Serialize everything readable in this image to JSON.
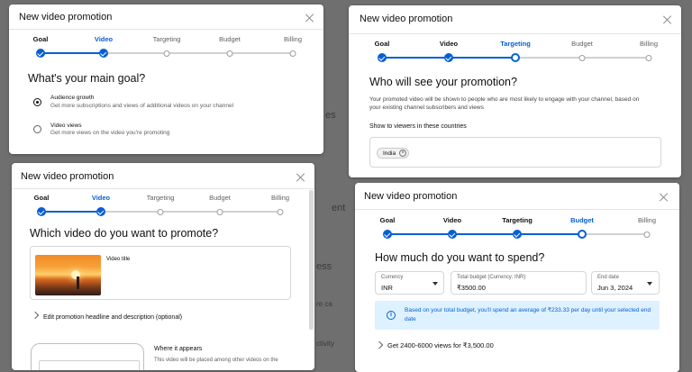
{
  "background": {
    "fragments": [
      "es",
      "ent",
      "ess",
      "re ca",
      "ss",
      "ctivity",
      "es",
      "re",
      "ss"
    ]
  },
  "dialog1": {
    "title": "New video promotion",
    "steps": [
      {
        "label": "Goal",
        "state": "done"
      },
      {
        "label": "Video",
        "state": "current"
      },
      {
        "label": "Targeting",
        "state": "todo"
      },
      {
        "label": "Budget",
        "state": "todo"
      },
      {
        "label": "Billing",
        "state": "todo"
      }
    ],
    "heading": "What's your main goal?",
    "options": [
      {
        "title": "Audience growth",
        "desc": "Get more subscriptions and views of additional videos on your channel",
        "checked": true
      },
      {
        "title": "Video views",
        "desc": "Get more views on the video you're promoting",
        "checked": false
      }
    ]
  },
  "dialog2": {
    "title": "New video promotion",
    "steps": [
      {
        "label": "Goal",
        "state": "done"
      },
      {
        "label": "Video",
        "state": "done"
      },
      {
        "label": "Targeting",
        "state": "current"
      },
      {
        "label": "Budget",
        "state": "todo"
      },
      {
        "label": "Billing",
        "state": "todo"
      }
    ],
    "heading": "Who will see your promotion?",
    "description": "Your promoted video will be shown to people who are most likely to engage with your channel, based on your existing channel subscribers and views",
    "countries_label": "Show to viewers in these countries",
    "country_chip": "India",
    "chip_remove_glyph": "×"
  },
  "dialog3": {
    "title": "New video promotion",
    "steps": [
      {
        "label": "Goal",
        "state": "done"
      },
      {
        "label": "Video",
        "state": "done"
      },
      {
        "label": "Targeting",
        "state": "todo"
      },
      {
        "label": "Budget",
        "state": "todo"
      },
      {
        "label": "Billing",
        "state": "todo"
      }
    ],
    "heading": "Which video do you want to promote?",
    "video_title": "Video title",
    "edit_label": "Edit promotion headline and description (optional)",
    "where_title": "Where it appears",
    "where_desc": "This video will be placed among other videos on the"
  },
  "dialog4": {
    "title": "New video promotion",
    "steps": [
      {
        "label": "Goal",
        "state": "done"
      },
      {
        "label": "Video",
        "state": "done"
      },
      {
        "label": "Targeting",
        "state": "done"
      },
      {
        "label": "Budget",
        "state": "current"
      },
      {
        "label": "Billing",
        "state": "todo"
      }
    ],
    "heading": "How much do you want to spend?",
    "currency_label": "Currency",
    "currency_value": "INR",
    "budget_label": "Total budget (Currency: INR)",
    "budget_value": "₹3500.00",
    "end_label": "End date",
    "end_value": "Jun 3, 2024",
    "info_glyph": "i",
    "info_line1": "Based on your total budget, you'll spend an average of ₹233.33 per day until your selected end",
    "info_line2": "date",
    "estimate": "Get 2400-6000 views for ₹3,500.00"
  },
  "colors": {
    "accent": "#065fd4",
    "info_bg": "#def1ff",
    "backdrop": "#6f6f6f"
  }
}
